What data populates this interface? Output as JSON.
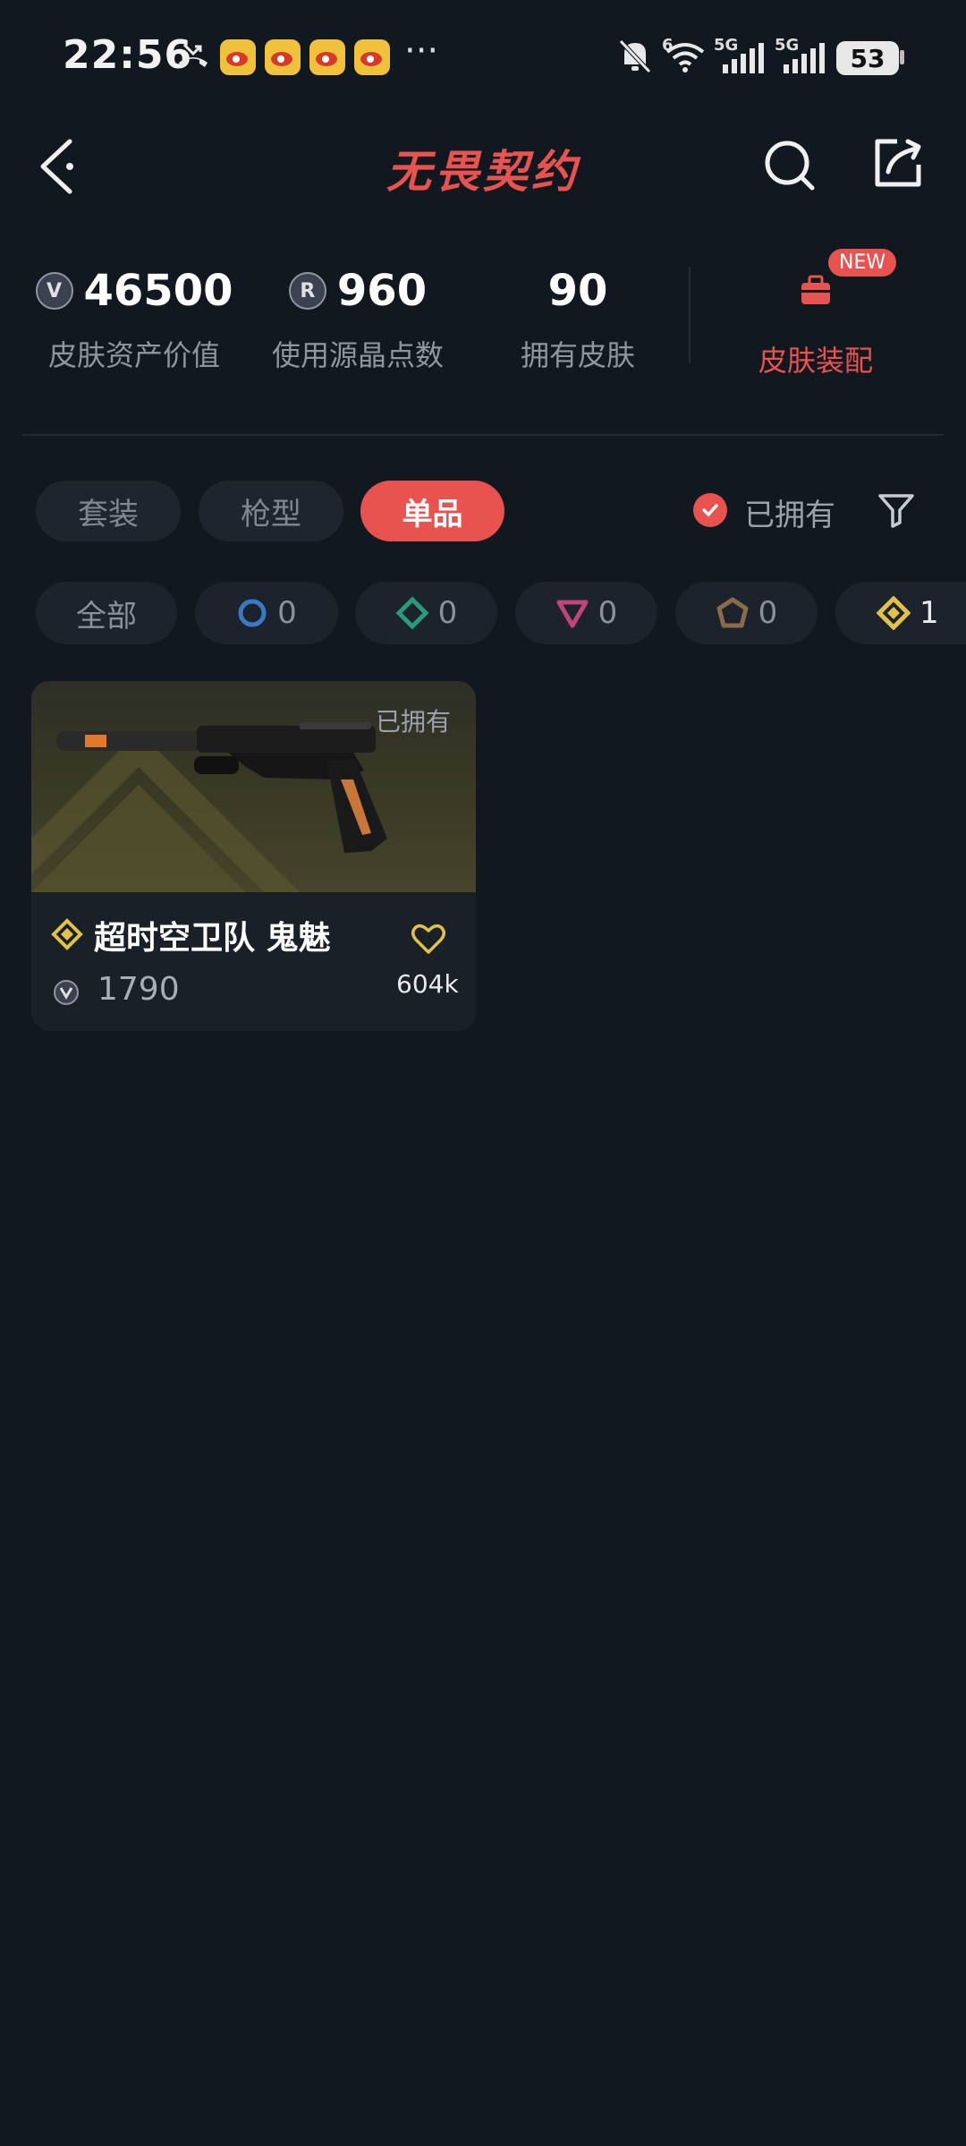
{
  "status_bar": {
    "time": "22:56",
    "battery": "53",
    "signal_1_label": "5G",
    "signal_2_label": "5G",
    "wifi_label": "6",
    "more": "···"
  },
  "header": {
    "logo_text": "无畏契约"
  },
  "stats": {
    "asset_value": {
      "value": "46500",
      "label": "皮肤资产价值"
    },
    "radianite": {
      "value": "960",
      "label": "使用源晶点数"
    },
    "owned": {
      "value": "90",
      "label": "拥有皮肤"
    },
    "loadout": {
      "label": "皮肤装配",
      "badge": "NEW"
    }
  },
  "tabs": [
    "套装",
    "枪型",
    "单品"
  ],
  "active_tab": "单品",
  "owned_filter_label": "已拥有",
  "rarity_chips": [
    {
      "label": "全部",
      "count": ""
    },
    {
      "icon": "select-tier-icon",
      "color": "#3a78c8",
      "count": "0"
    },
    {
      "icon": "deluxe-tier-icon",
      "color": "#2a9a7e",
      "count": "0"
    },
    {
      "icon": "premium-tier-icon",
      "color": "#c0457d",
      "count": "0"
    },
    {
      "icon": "ultra-tier-icon",
      "color": "#8a6a48",
      "count": "0"
    },
    {
      "icon": "exclusive-tier-icon",
      "color": "#e0c24a",
      "count": "1"
    }
  ],
  "skin_card": {
    "owned_tag": "已拥有",
    "name": "超时空卫队 鬼魅",
    "price": "1790",
    "likes": "604k"
  },
  "colors": {
    "background": "#121820",
    "accent": "#e8534f",
    "gold": "#e0c24a"
  }
}
